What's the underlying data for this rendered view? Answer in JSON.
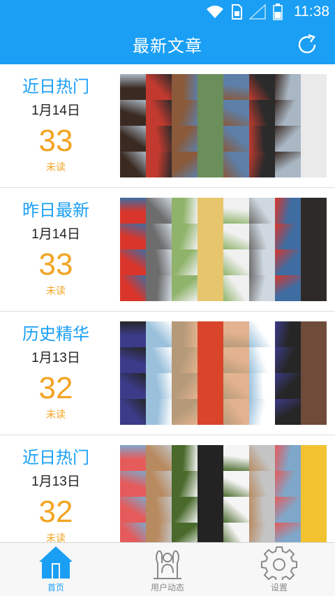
{
  "status_bar": {
    "time": "11:38"
  },
  "header": {
    "title": "最新文章"
  },
  "sections": [
    {
      "title": "近日热门",
      "date": "1月14日",
      "count": "33",
      "unread_label": "未读",
      "palette": [
        "#3a2a22",
        "#6b8f5a",
        "#a9b7c4",
        "#c23a2f",
        "#5d7fa8",
        "#eaeaea",
        "#8a5a3a",
        "#2b2b2b"
      ]
    },
    {
      "title": "昨日最新",
      "date": "1月14日",
      "count": "33",
      "unread_label": "未读",
      "palette": [
        "#cfd8e0",
        "#d9352b",
        "#e6c56d",
        "#3f6da2",
        "#6d6d6d",
        "#f0f0f0",
        "#2d2a28",
        "#8fb36a"
      ]
    },
    {
      "title": "历史精华",
      "date": "1月13日",
      "count": "32",
      "unread_label": "未读",
      "palette": [
        "#b59a7a",
        "#ffffff",
        "#3b3b8a",
        "#d8452a",
        "#262626",
        "#9ac0dc",
        "#e3b28e",
        "#6f4b3a"
      ]
    },
    {
      "title": "近日热门",
      "date": "1月13日",
      "count": "32",
      "unread_label": "未读",
      "palette": [
        "#f2c230",
        "#4a6a2c",
        "#c4c4c4",
        "#e55b5b",
        "#232323",
        "#7fa7c9",
        "#b88a60",
        "#f5f5f5"
      ]
    }
  ],
  "tabbar": [
    {
      "label": "首页",
      "icon": "home-icon",
      "active": true
    },
    {
      "label": "用户动态",
      "icon": "users-icon",
      "active": false
    },
    {
      "label": "设置",
      "icon": "gear-icon",
      "active": false
    }
  ],
  "colors": {
    "accent": "#1a9ff5",
    "count": "#f2a423"
  }
}
